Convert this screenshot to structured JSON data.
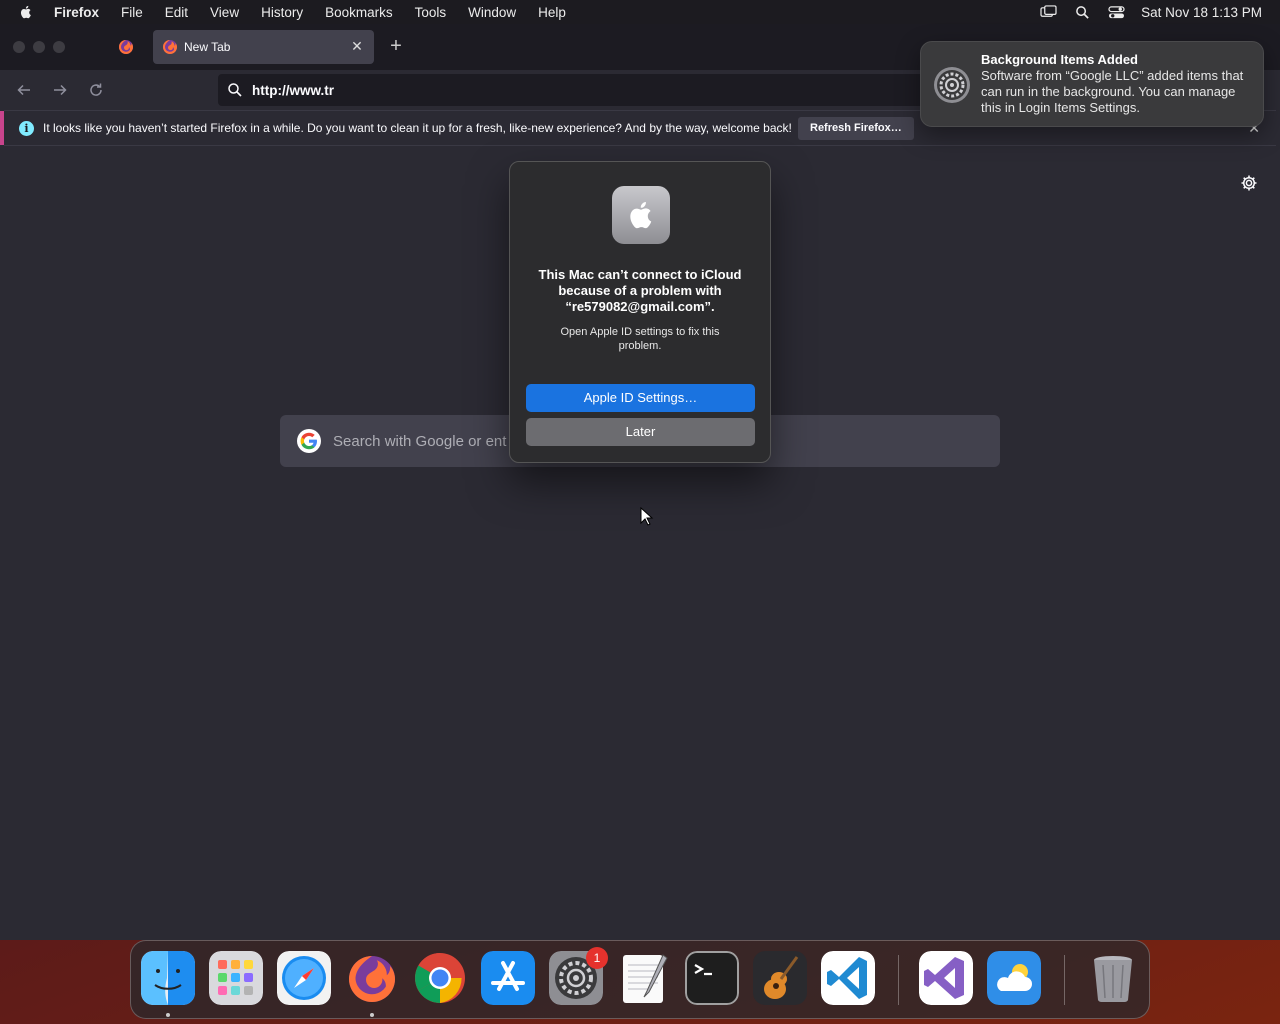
{
  "menubar": {
    "app_name": "Firefox",
    "items": [
      "File",
      "Edit",
      "View",
      "History",
      "Bookmarks",
      "Tools",
      "Window",
      "Help"
    ],
    "clock": "Sat Nov 18  1:13 PM"
  },
  "browser": {
    "tab": {
      "title": "New Tab"
    },
    "url": "http://www.tr",
    "infobar": {
      "message": "It looks like you haven’t started Firefox in a while. Do you want to clean it up for a fresh, like-new experience? And by the way, welcome back!",
      "button": "Refresh Firefox…"
    },
    "search": {
      "placeholder": "Search with Google or ent"
    }
  },
  "dialog": {
    "title": "This Mac can’t connect to iCloud because of a problem with “re579082@gmail.com”.",
    "message": "Open Apple ID settings to fix this problem.",
    "primary_button": "Apple ID Settings…",
    "secondary_button": "Later"
  },
  "notification": {
    "title": "Background Items Added",
    "body": "Software from “Google LLC” added items that can run in the background. You can manage this in Login Items Settings."
  },
  "dock": {
    "badge_settings": "1",
    "apps": [
      "finder-icon",
      "launchpad-icon",
      "safari-icon",
      "firefox-icon",
      "chrome-icon",
      "app-store-icon",
      "system-settings-icon",
      "textedit-icon",
      "terminal-icon",
      "garageband-icon",
      "vscode-icon",
      "visual-studio-icon",
      "weather-icon",
      "trash-icon"
    ]
  },
  "colors": {
    "accent_blue": "#1a73e0",
    "infobar_stripe": "#c8448c",
    "info_icon": "#80ebff",
    "badge_red": "#e5322d"
  }
}
